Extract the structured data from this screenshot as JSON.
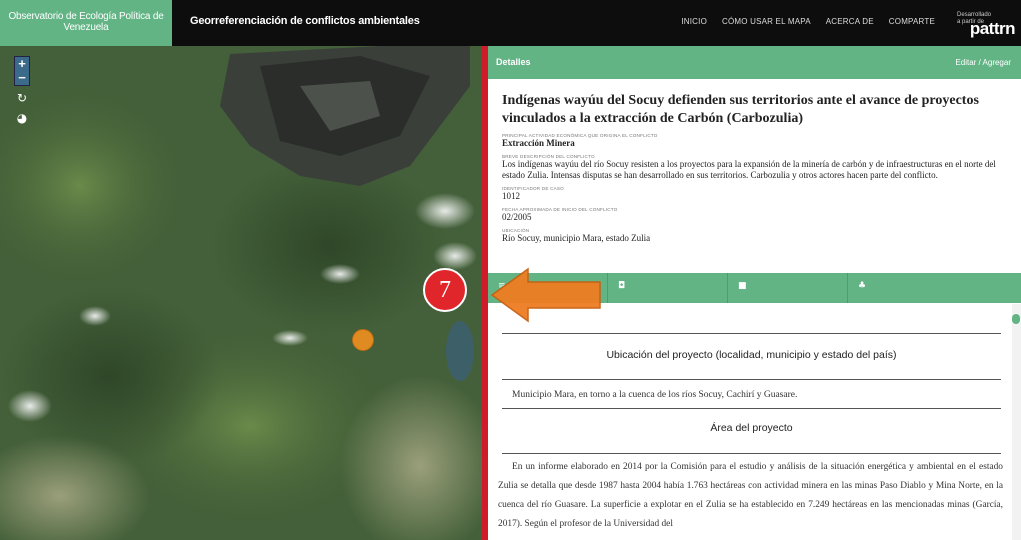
{
  "nav": {
    "brand": "Observatorio de Ecología Política de Venezuela",
    "subtitle": "Georreferenciación de conflictos ambientales",
    "links": [
      "INICIO",
      "CÓMO USAR EL MAPA",
      "ACERCA DE",
      "COMPARTE"
    ],
    "powered_by": "Desarrollado a partir de",
    "logo_text": "pattrn"
  },
  "map": {
    "controls": {
      "zoom_in": "+",
      "zoom_out": "−",
      "refresh_icon": "refresh-icon",
      "globe_icon": "globe-icon"
    },
    "marker_color": "#e08a22"
  },
  "panel": {
    "header_title": "Detalles",
    "header_edit": "Editar / Agregar",
    "case_title": "Indígenas wayúu del Socuy defienden sus territorios ante el avance de proyectos vinculados a la extracción de Carbón (Carbozulia)",
    "fields": [
      {
        "label": "PRINCIPAL ACTIVIDAD ECONÓMICA QUE ORIGINA EL CONFLICTO",
        "value": "Extracción Minera",
        "bold": true
      },
      {
        "label": "BREVE DESCRIPCIÓN DEL CONFLICTO",
        "value": "Los indígenas wayúu del río Socuy resisten a los proyectos para la expansión de la minería de carbón y de infraestructuras en el norte del estado Zulia. Intensas disputas se han desarrollado en sus territorios. Carbozulia y otros actores hacen parte del conflicto.",
        "bold": false
      },
      {
        "label": "IDENTIFICADOR DE CASO",
        "value": "1012",
        "bold": false
      },
      {
        "label": "FECHA APROXIMADA DE INICIO DEL CONFLICTO",
        "value": "02/2005",
        "bold": false
      },
      {
        "label": "UBICACIÓN",
        "value": "Río Socuy, municipio Mara, estado Zulia",
        "bold": false
      }
    ],
    "tabs": [
      {
        "icon": "≡",
        "name": "list-icon"
      },
      {
        "icon": "◘",
        "name": "camera-icon"
      },
      {
        "icon": "■",
        "name": "video-icon"
      },
      {
        "icon": "♣",
        "name": "tree-icon"
      }
    ],
    "section1_title": "Ubicación del proyecto (localidad, municipio y estado del país)",
    "section1_text": "Municipio Mara, en torno a la cuenca de los ríos Socuy, Cachirí y Guasare.",
    "section2_title": "Área del proyecto",
    "section2_text": "En un informe elaborado en 2014 por la Comisión para el estudio y análisis de la situación energética y ambiental en el estado Zulia se detalla que desde 1987 hasta 2004 había 1.763 hectáreas con actividad minera en las minas Paso Diablo y Mina Norte, en la cuenca del río Guasare. La superficie a explotar en el Zulia se ha establecido en 7.249 hectáreas en las mencionadas minas (García, 2017). Según el profesor de la Universidad del",
    "accent": "#62b485"
  },
  "annotation": {
    "step_number": "7",
    "badge_color": "#e0252b",
    "arrow_color": "#ef7d22"
  }
}
